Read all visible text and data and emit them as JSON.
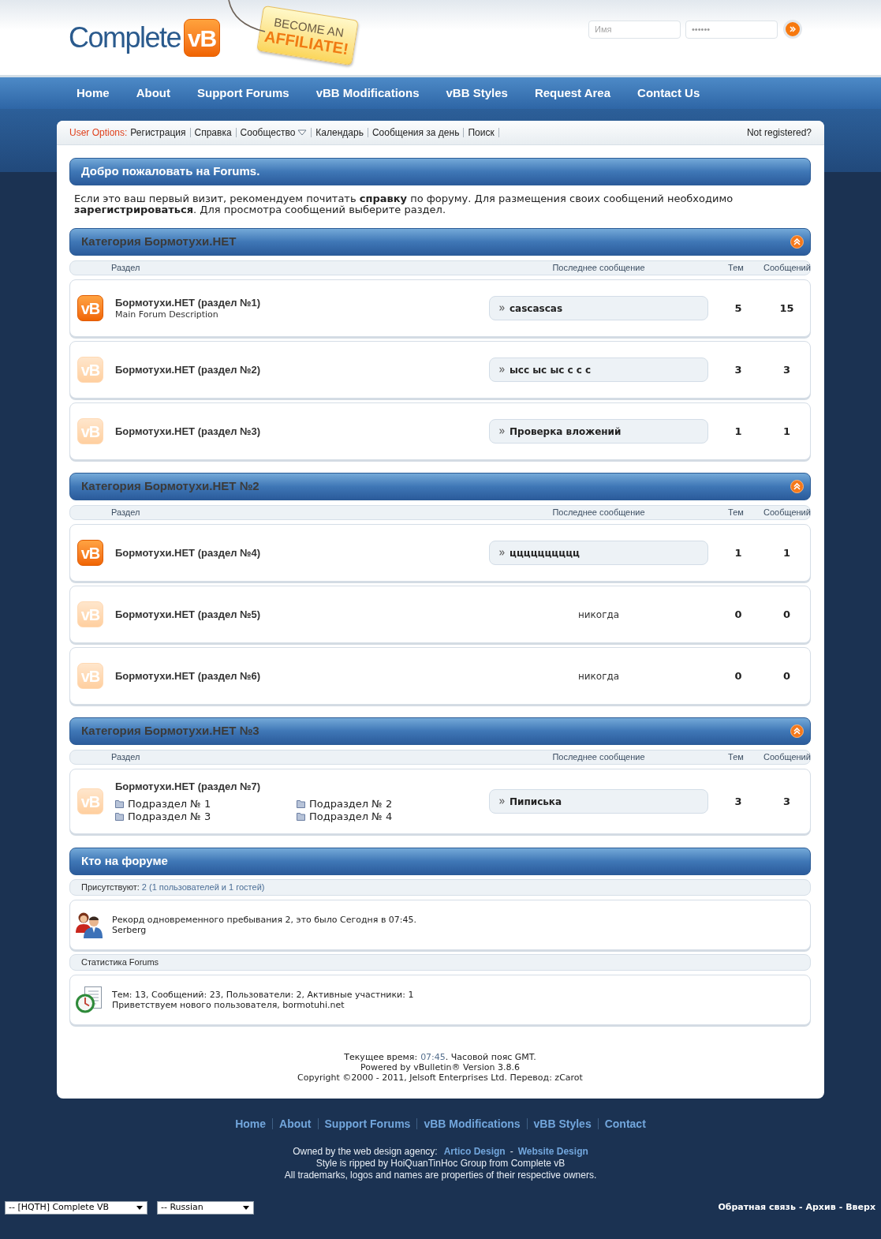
{
  "header": {
    "logo_text": "Complete",
    "logo_badge": "vB",
    "affiliate_tag": [
      "BECOME AN",
      "AFFILIATE!"
    ],
    "login": {
      "username_placeholder": "Имя",
      "password_value": "••••••"
    }
  },
  "nav": [
    "Home",
    "About",
    "Support Forums",
    "vBB Modifications",
    "vBB Styles",
    "Request Area",
    "Contact Us"
  ],
  "user_options": {
    "label": "User Options:",
    "links": [
      {
        "label": "Регистрация",
        "dropdown": false
      },
      {
        "label": "Справка",
        "dropdown": false
      },
      {
        "label": "Сообщество",
        "dropdown": true
      },
      {
        "label": "Календарь",
        "dropdown": false
      },
      {
        "label": "Сообщения за день",
        "dropdown": false
      },
      {
        "label": "Поиск",
        "dropdown": false
      }
    ],
    "status": "Not registered?"
  },
  "welcome": {
    "title": "Добро пожаловать на Forums.",
    "text": "Если это ваш первый визит, рекомендуем почитать **справку** по форуму. Для размещения своих сообщений необходимо **зарегистрироваться**. Для просмотра сообщений выберите раздел."
  },
  "categories": [
    {
      "title": "Категория Бормотухи.НЕТ",
      "expanded": true,
      "columns": [
        "Раздел",
        "Последнее сообщение",
        "Тем",
        "Сообщений"
      ],
      "forums": [
        {
          "icon_label": "vB",
          "has_new": true,
          "title": "Бормотухи.НЕТ (раздел №1)",
          "description": "Main Forum Description",
          "last_post": {
            "kind": "thread",
            "text": "cascascas"
          },
          "threads": "5",
          "posts": "15"
        },
        {
          "icon_label": "vB",
          "has_new": false,
          "title": "Бормотухи.НЕТ (раздел №2)",
          "last_post": {
            "kind": "thread",
            "text": "ысс ыс ыс с с с"
          },
          "threads": "3",
          "posts": "3"
        },
        {
          "icon_label": "vB",
          "has_new": false,
          "title": "Бормотухи.НЕТ (раздел №3)",
          "last_post": {
            "kind": "thread",
            "text": "Проверка вложений"
          },
          "threads": "1",
          "posts": "1"
        }
      ]
    },
    {
      "title": "Категория Бормотухи.НЕТ №2",
      "expanded": true,
      "columns": [
        "Раздел",
        "Последнее сообщение",
        "Тем",
        "Сообщений"
      ],
      "forums": [
        {
          "icon_label": "vB",
          "has_new": true,
          "title": "Бормотухи.НЕТ (раздел №4)",
          "last_post": {
            "kind": "thread",
            "text": "цццццццццц"
          },
          "threads": "1",
          "posts": "1"
        },
        {
          "icon_label": "vB",
          "has_new": false,
          "title": "Бормотухи.НЕТ (раздел №5)",
          "last_post": {
            "kind": "never",
            "text": "никогда"
          },
          "threads": "0",
          "posts": "0"
        },
        {
          "icon_label": "vB",
          "has_new": false,
          "title": "Бормотухи.НЕТ (раздел №6)",
          "last_post": {
            "kind": "never",
            "text": "никогда"
          },
          "threads": "0",
          "posts": "0"
        }
      ]
    },
    {
      "title": "Категория Бормотухи.НЕТ №3",
      "expanded": true,
      "columns": [
        "Раздел",
        "Последнее сообщение",
        "Тем",
        "Сообщений"
      ],
      "forums": [
        {
          "icon_label": "vB",
          "has_new": false,
          "title": "Бормотухи.НЕТ (раздел №7)",
          "subforums": [
            "Подраздел № 1",
            "Подраздел № 2",
            "Подраздел № 3",
            "Подраздел № 4"
          ],
          "last_post": {
            "kind": "thread",
            "text": "Пиписька"
          },
          "threads": "3",
          "posts": "3"
        }
      ]
    }
  ],
  "whos_online": {
    "title": "Кто на форуме",
    "sections": [
      {
        "kind": "users",
        "heading": "Присутствуют:",
        "heading_value": "2 (1 пользователей и 1 гостей)",
        "lines": [
          "Рекорд одновременного пребывания 2, это было Сегодня в 07:45.",
          "Serberg"
        ]
      },
      {
        "kind": "stats",
        "heading": "Статистика Forums",
        "lines": [
          "Тем: 13, Сообщений: 23, Пользователи: 2, Активные участники: 1",
          "Приветствуем нового пользователя, bormotuhi.net"
        ]
      }
    ]
  },
  "page_footer": {
    "time_label": "Текущее время:",
    "time": "07:45",
    "time_suffix": ". Часовой пояс GMT.",
    "lines": [
      "Powered by vBulletin® Version 3.8.6",
      "Copyright ©2000 - 2011, Jelsoft Enterprises Ltd. Перевод: zCarot"
    ]
  },
  "footer_nav": [
    "Home",
    "About",
    "Support Forums",
    "vBB Modifications",
    "vBB Styles",
    "Contact"
  ],
  "credits": {
    "owned_label": "Owned by the web design agency:",
    "links": [
      "Artico Design",
      "Website Design"
    ],
    "link_separator": "-",
    "lines": [
      "Style is ripped by HoiQuanTinHoc Group from Complete vB",
      "All trademarks, logos and names are properties of their respective owners."
    ]
  },
  "bottom_bar": {
    "selects": [
      "-- [HQTH] Complete VB",
      "-- Russian"
    ],
    "links": [
      "Обратная связь",
      "Архив",
      "Вверх"
    ],
    "link_separator": "-"
  }
}
